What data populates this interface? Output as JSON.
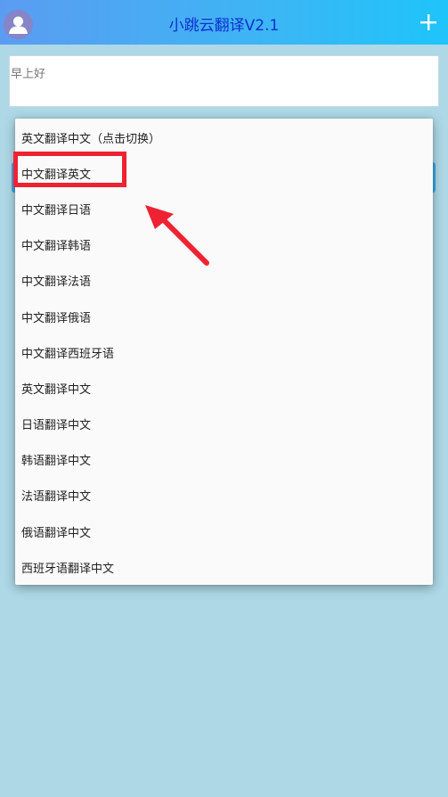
{
  "header": {
    "title": "小跳云翻译V2.1",
    "avatar_icon": "user-icon",
    "add_icon": "plus-icon"
  },
  "input": {
    "text": "早上好"
  },
  "menu": {
    "items": [
      {
        "label": "英文翻译中文（点击切换）"
      },
      {
        "label": "中文翻译英文"
      },
      {
        "label": "中文翻译日语"
      },
      {
        "label": "中文翻译韩语"
      },
      {
        "label": "中文翻译法语"
      },
      {
        "label": "中文翻译俄语"
      },
      {
        "label": "中文翻译西班牙语"
      },
      {
        "label": "英文翻译中文"
      },
      {
        "label": "日语翻译中文"
      },
      {
        "label": "韩语翻译中文"
      },
      {
        "label": "法语翻译中文"
      },
      {
        "label": "俄语翻译中文"
      },
      {
        "label": "西班牙语翻译中文"
      }
    ]
  },
  "annotation": {
    "highlight_color": "#ee2233",
    "arrow_icon": "arrow-icon"
  }
}
